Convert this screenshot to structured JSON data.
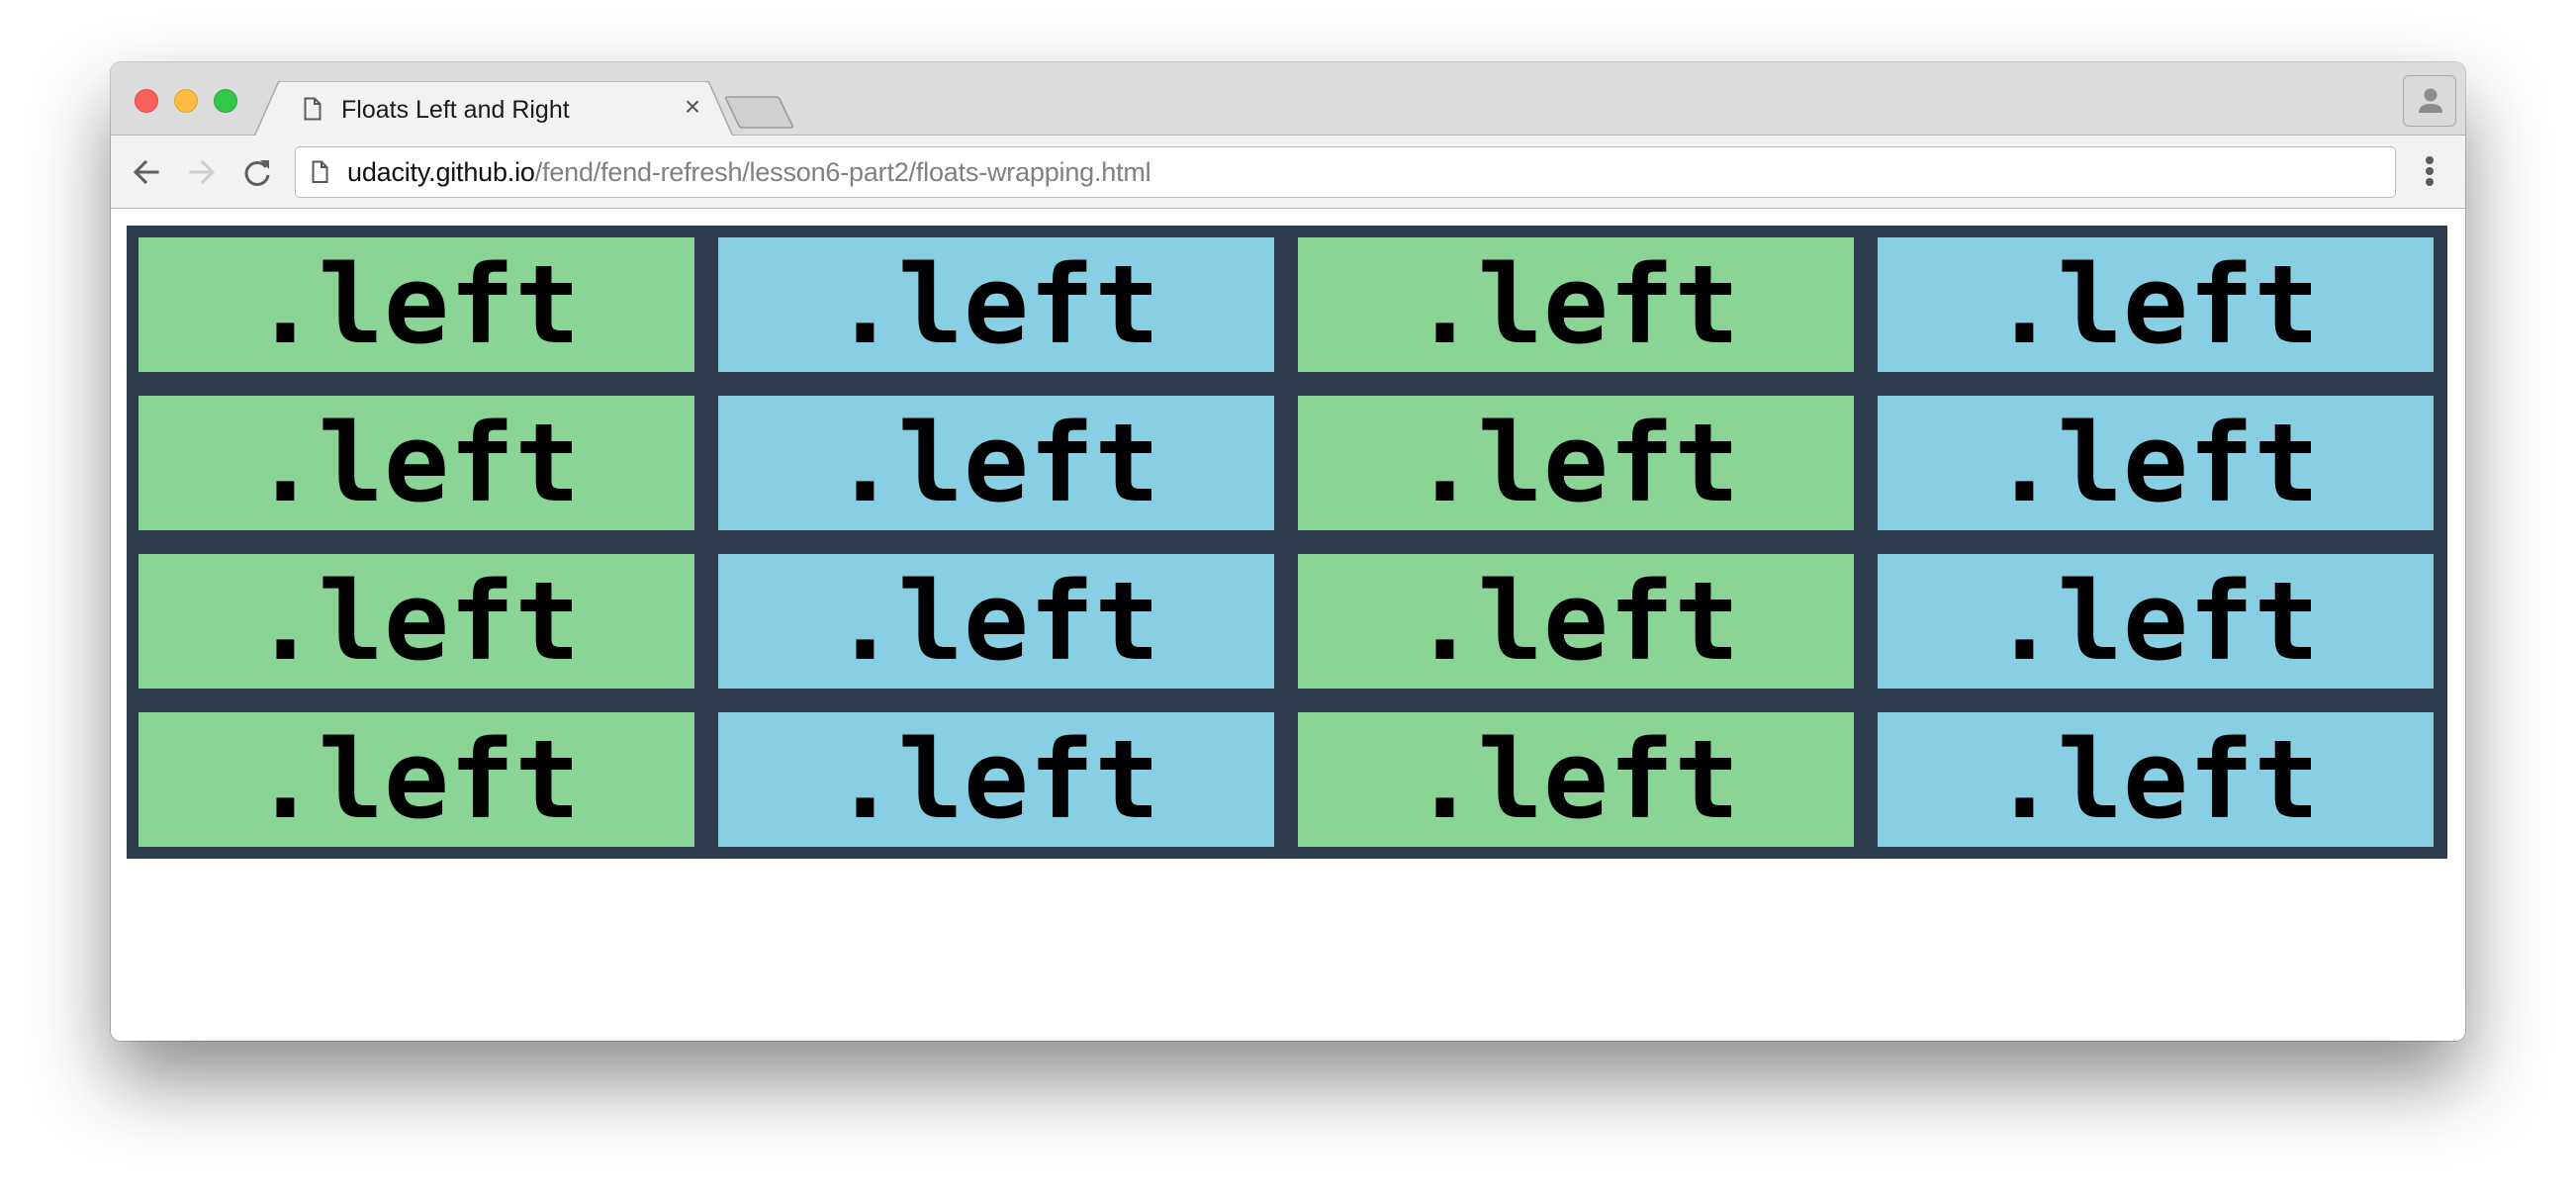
{
  "browser": {
    "tab": {
      "title": "Floats Left and Right",
      "icon": "page-icon",
      "close_icon": "close-icon"
    },
    "address_bar": {
      "host": "udacity.github.io",
      "path": "/fend/fend-refresh/lesson6-part2/floats-wrapping.html"
    },
    "nav": {
      "back_icon": "arrow-left-icon",
      "forward_icon": "arrow-right-icon",
      "reload_icon": "reload-icon",
      "menu_icon": "kebab-menu-icon",
      "profile_icon": "person-icon"
    }
  },
  "colors": {
    "container": "#2e3d4d",
    "green": "#8ad596",
    "blue": "#88cfe4"
  },
  "page": {
    "boxes": [
      {
        "label": ".left",
        "color": "green"
      },
      {
        "label": ".left",
        "color": "blue"
      },
      {
        "label": ".left",
        "color": "green"
      },
      {
        "label": ".left",
        "color": "blue"
      },
      {
        "label": ".left",
        "color": "green"
      },
      {
        "label": ".left",
        "color": "blue"
      },
      {
        "label": ".left",
        "color": "green"
      },
      {
        "label": ".left",
        "color": "blue"
      },
      {
        "label": ".left",
        "color": "green"
      },
      {
        "label": ".left",
        "color": "blue"
      },
      {
        "label": ".left",
        "color": "green"
      },
      {
        "label": ".left",
        "color": "blue"
      },
      {
        "label": ".left",
        "color": "green"
      },
      {
        "label": ".left",
        "color": "blue"
      },
      {
        "label": ".left",
        "color": "green"
      },
      {
        "label": ".left",
        "color": "blue"
      }
    ]
  }
}
